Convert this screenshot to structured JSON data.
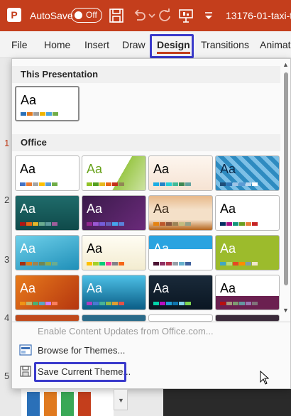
{
  "titlebar": {
    "logo_letter": "P",
    "autosave_label": "AutoSave",
    "toggle_label": "Off",
    "filename": "13176-01-taxi-th"
  },
  "ribbon": {
    "tabs": [
      {
        "label": "File"
      },
      {
        "label": "Home"
      },
      {
        "label": "Insert"
      },
      {
        "label": "Draw"
      },
      {
        "label": "Design"
      },
      {
        "label": "Transitions"
      },
      {
        "label": "Animati"
      }
    ],
    "active_tab": "Design"
  },
  "slide_numbers": [
    "1",
    "2",
    "3",
    "4",
    "5"
  ],
  "panel": {
    "this_presentation_header": "This Presentation",
    "office_header": "Office",
    "theme_aa": "Aa",
    "menu": {
      "enable_updates": "Enable Content Updates from Office.com...",
      "browse": "Browse for Themes...",
      "save": "Save Current Theme..."
    }
  },
  "colors": {
    "accent": "#c43e1c",
    "callout": "#3a3acb"
  }
}
